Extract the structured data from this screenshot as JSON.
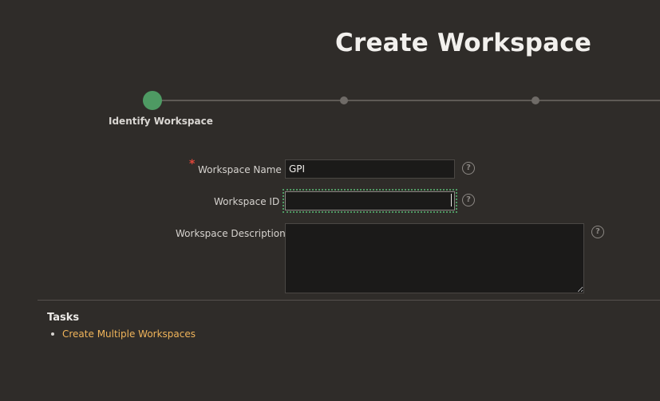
{
  "page": {
    "title": "Create Workspace"
  },
  "wizard": {
    "current_step_label": "Identify Workspace"
  },
  "form": {
    "workspace_name": {
      "label": "Workspace Name",
      "required_marker": "*",
      "value": "GPI",
      "help_icon": "question-circle-icon"
    },
    "workspace_id": {
      "label": "Workspace ID",
      "value": "",
      "help_icon": "question-circle-icon"
    },
    "workspace_description": {
      "label": "Workspace Description",
      "value": "",
      "help_icon": "question-circle-icon"
    },
    "help_glyph": "?"
  },
  "tasks": {
    "heading": "Tasks",
    "items": [
      {
        "label": "Create Multiple Workspaces"
      }
    ]
  },
  "colors": {
    "background": "#2f2c29",
    "accent_green": "#4e9a63",
    "link": "#f0b45a",
    "required": "#e0463a"
  }
}
